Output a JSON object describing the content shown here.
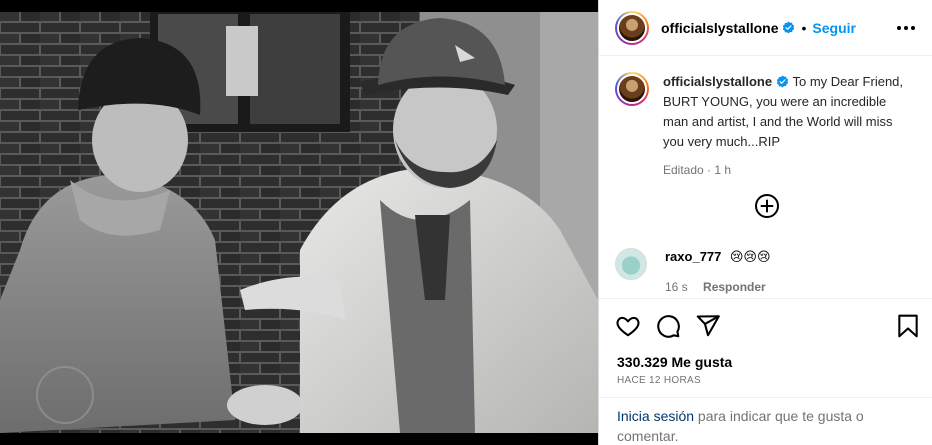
{
  "post": {
    "image_alt": "photo-two-men",
    "username": "officialslystallone",
    "follow_label": "Seguir",
    "separator": "•",
    "caption_text": "To my Dear Friend, BURT YOUNG, you were an incredible man and artist, I and the World will miss you very much...RIP",
    "caption_meta": "Editado · 1 h",
    "likes": "330.329 Me gusta",
    "timestamp": "HACE 12 HORAS"
  },
  "comment": {
    "username": "raxo_777",
    "text": "😢😢😢",
    "age": "16 s",
    "reply_label": "Responder"
  },
  "login": {
    "link_label": "Inicia sesión",
    "rest": " para indicar que te gusta o comentar."
  },
  "colors": {
    "accent": "#0095f6",
    "link": "#00376b",
    "muted": "#737373"
  },
  "icons": [
    "verified-badge-icon",
    "more-options-icon",
    "add-comment-icon",
    "heart-icon",
    "comment-icon",
    "share-icon",
    "bookmark-icon"
  ]
}
